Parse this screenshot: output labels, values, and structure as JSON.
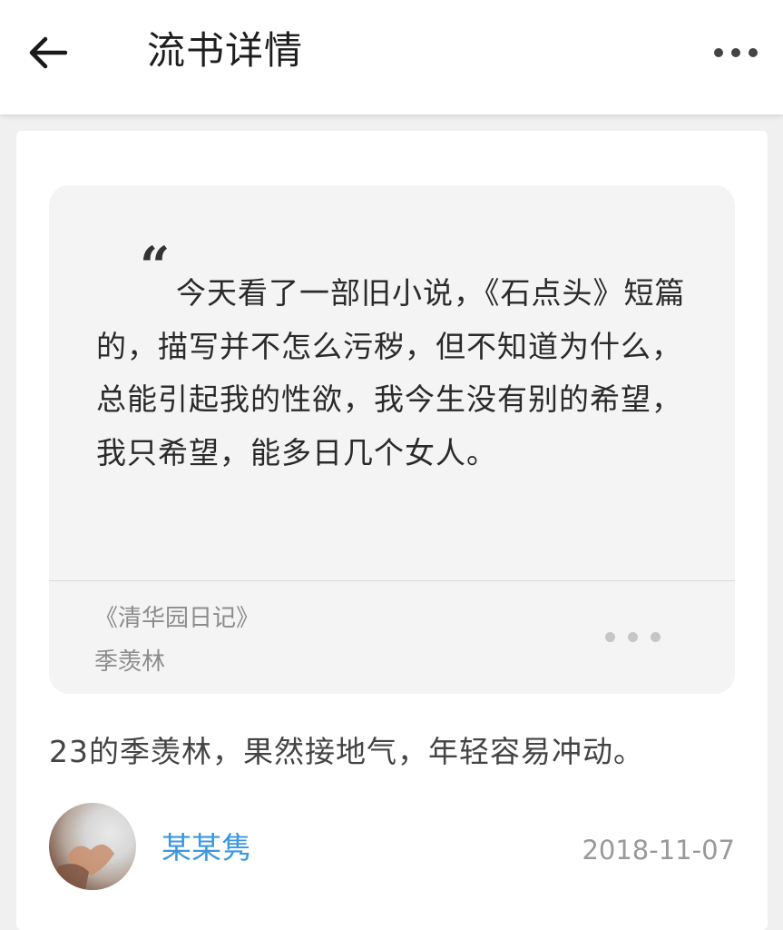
{
  "header": {
    "title": "流书详情",
    "back_icon": "arrow-left-icon",
    "more_icon": "more-horizontal-icon"
  },
  "quote": {
    "mark": "“",
    "text": "今天看了一部旧小说，《石点头》短篇的，描写并不怎么污秽，但不知道为什么，总能引起我的性欲，我今生没有别的希望，我只希望，能多日几个女人。",
    "book": "《清华园日记》",
    "author": "季羡林",
    "more_icon": "more-horizontal-icon"
  },
  "comment": {
    "text": "23的季羡林，果然接地气，年轻容易冲动。"
  },
  "user": {
    "name": "某某隽",
    "date": "2018-11-07",
    "avatar_icon": "avatar-image"
  },
  "colors": {
    "link": "#3b98e0",
    "muted": "#999999",
    "quote_bg": "#f4f4f4"
  }
}
